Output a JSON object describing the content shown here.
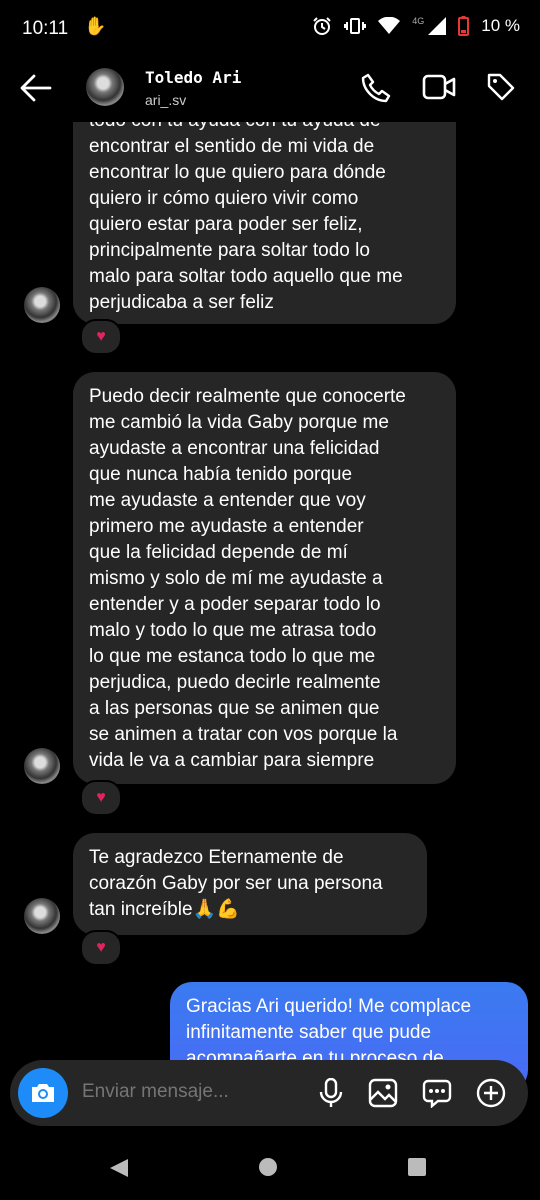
{
  "status": {
    "time": "10:11",
    "network": "4G",
    "battery": "10 %"
  },
  "header": {
    "name": "Toledo Ari",
    "username": "ari_.sv"
  },
  "messages": {
    "m1": {
      "lines": [
        "todo con tu ayuda con tu ayuda de",
        "encontrar el sentido de mi vida de",
        "encontrar lo que quiero para dónde",
        "quiero ir cómo quiero vivir como",
        "quiero estar para poder ser feliz,",
        "principalmente para soltar todo lo",
        "malo para soltar todo aquello que me",
        "perjudicaba a ser feliz"
      ],
      "reaction": "♥"
    },
    "m2": {
      "lines": [
        "Puedo decir realmente que conocerte",
        "me cambió la vida Gaby porque me",
        "ayudaste a encontrar una felicidad",
        "que nunca había tenido porque",
        "me ayudaste a entender que voy",
        "primero me ayudaste a entender",
        "que la felicidad depende de mí",
        "mismo y solo de mí me ayudaste a",
        "entender y a poder separar todo lo",
        "malo y todo lo que me atrasa todo",
        "lo que me estanca todo lo que me",
        "perjudica, puedo decirle realmente",
        "a las personas que se animen que",
        "se animen a tratar con vos porque la",
        "vida le va a cambiar para siempre"
      ],
      "reaction": "♥"
    },
    "m3": {
      "lines": [
        "Te agradezco Eternamente de",
        "corazón Gaby por ser una persona",
        "tan increíble🙏💪"
      ],
      "reaction": "♥"
    },
    "m4": {
      "lines": [
        "Gracias Ari querido! Me complace",
        "infinitamente saber que pude",
        "acompañarte en tu proceso de"
      ]
    }
  },
  "composer": {
    "placeholder": "Enviar mensaje..."
  }
}
